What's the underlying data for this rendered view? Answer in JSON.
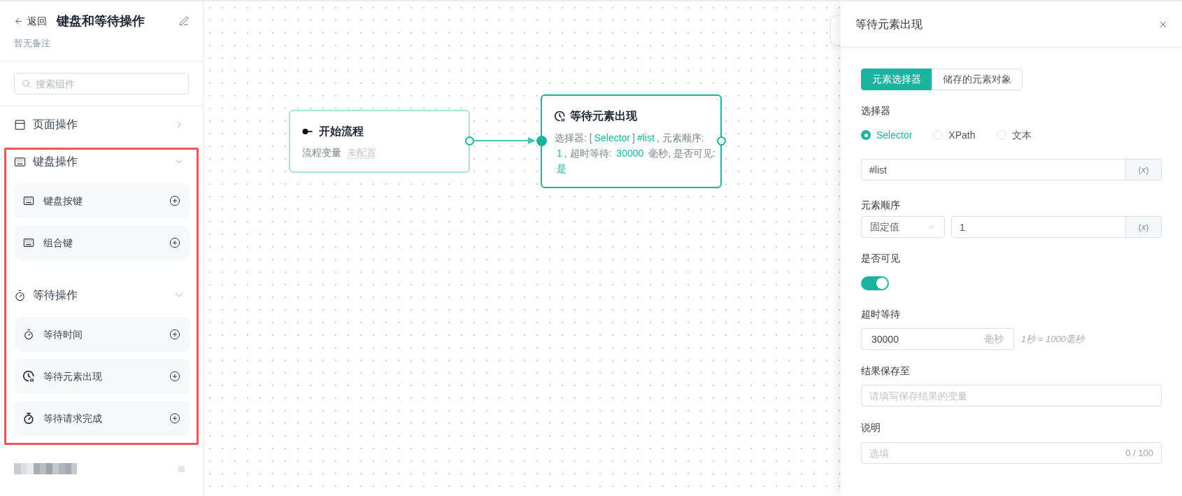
{
  "sidebar": {
    "back": "返回",
    "title": "键盘和等待操作",
    "note": "暂无备注",
    "search": {
      "placeholder": "搜索组件"
    },
    "groups": [
      {
        "title": "页面操作",
        "kind": "window",
        "expanded": false,
        "highlighted": false
      },
      {
        "title": "键盘操作",
        "kind": "keyboard",
        "expanded": true,
        "highlighted": true,
        "items": [
          {
            "label": "键盘按键",
            "kind": "keyboard"
          },
          {
            "label": "组合键",
            "kind": "keyboard"
          }
        ]
      },
      {
        "title": "等待操作",
        "kind": "timer",
        "expanded": true,
        "highlighted": true,
        "items": [
          {
            "label": "等待时间",
            "kind": "timer"
          },
          {
            "label": "等待元素出现",
            "kind": "clock"
          },
          {
            "label": "等待请求完成",
            "kind": "stopwatch"
          }
        ]
      }
    ]
  },
  "canvas": {
    "nodes": [
      {
        "kind": "start",
        "title": "开始流程",
        "selected": false,
        "outgoing": true,
        "field": {
          "label": "流程变量",
          "value": "未配置"
        }
      },
      {
        "kind": "wait",
        "title": "等待元素出现",
        "selected": true,
        "outgoing": false,
        "summary": [
          {
            "text": "选择器: [",
            "kind": "plain"
          },
          {
            "text": "Selector",
            "kind": "value"
          },
          {
            "text": "]",
            "kind": "plain"
          },
          {
            "text": "#list",
            "kind": "value"
          },
          {
            "text": ", 元素顺序: ",
            "kind": "plain"
          },
          {
            "text": "1",
            "kind": "value"
          },
          {
            "text": ", 超时等待: ",
            "kind": "plain"
          },
          {
            "text": "30000",
            "kind": "value"
          },
          {
            "text": " 毫秒, 是否可见: ",
            "kind": "plain"
          },
          {
            "text": "是",
            "kind": "value"
          }
        ]
      }
    ]
  },
  "panel": {
    "title": "等待元素出现",
    "tabs": [
      {
        "label": "元素选择器",
        "selected": true
      },
      {
        "label": "储存的元素对象",
        "selected": false
      }
    ],
    "selector": {
      "label": "选择器",
      "options": [
        {
          "label": "Selector",
          "selected": true
        },
        {
          "label": "XPath",
          "selected": false
        },
        {
          "label": "文本",
          "selected": false
        }
      ],
      "value": "#list",
      "addon": "(*x*)"
    },
    "order": {
      "label": "元素顺序",
      "mode": "固定值",
      "value": "1",
      "addon": "(*x*)"
    },
    "visible": {
      "label": "是否可见",
      "on": true
    },
    "timeout": {
      "label": "超时等待",
      "value": "30000",
      "unit": "毫秒",
      "hint": "1秒 = 1000毫秒"
    },
    "save_to": {
      "label": "结果保存至",
      "placeholder": "请填写保存结果的变量"
    },
    "description": {
      "label": "说明",
      "placeholder": "选填",
      "counter": "0 / 100"
    }
  }
}
